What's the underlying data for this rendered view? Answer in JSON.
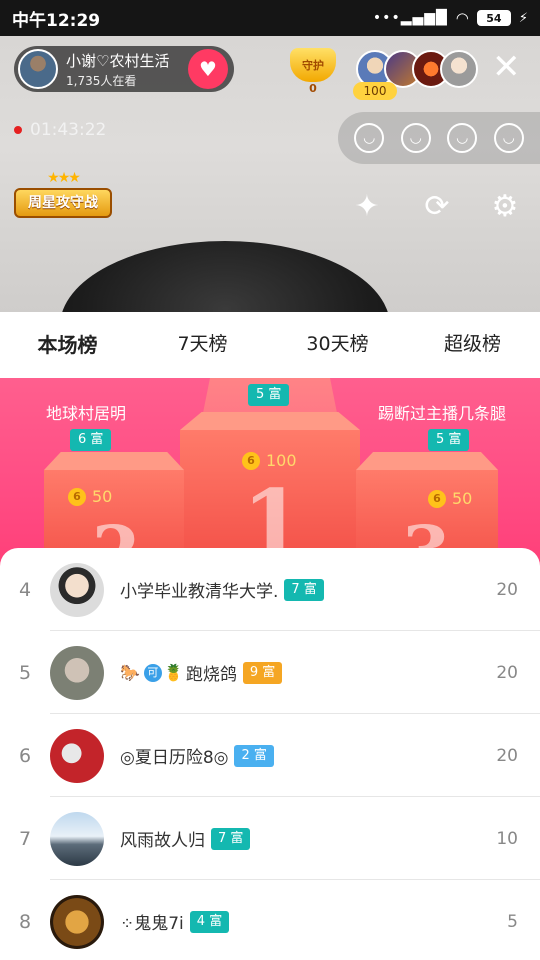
{
  "status_bar": {
    "time": "中午12:29",
    "battery": "54"
  },
  "host": {
    "name": "小谢♡农村生活",
    "viewers": "1,735人在看"
  },
  "guard": {
    "label": "守护",
    "count": "0"
  },
  "top_badge": "100",
  "live_timer": "01:43:22",
  "week_badge": "周星攻守战",
  "tabs": [
    {
      "label": "本场榜",
      "active": true
    },
    {
      "label": "7天榜",
      "active": false
    },
    {
      "label": "30天榜",
      "active": false
    },
    {
      "label": "超级榜",
      "active": false
    }
  ],
  "podium": {
    "first": {
      "rich": "5 富",
      "coins": "100",
      "rank": "1"
    },
    "second": {
      "name": "地球村居明",
      "rich": "6 富",
      "coins": "50",
      "rank": "2"
    },
    "third": {
      "name": "踢断过主播几条腿",
      "rich": "5 富",
      "coins": "50",
      "rank": "3"
    }
  },
  "ranking": [
    {
      "rank": "4",
      "name": "小学毕业教清华大学.",
      "level": "7 富",
      "level_color": "#14b8b0",
      "score": "20"
    },
    {
      "rank": "5",
      "name": "跑烧鸽",
      "level": "9 富",
      "level_color": "#f5a623",
      "score": "20"
    },
    {
      "rank": "6",
      "name": "◎夏日历险8◎",
      "level": "2 富",
      "level_color": "#4ab0f0",
      "score": "20"
    },
    {
      "rank": "7",
      "name": "风雨故人归",
      "level": "7 富",
      "level_color": "#14b8b0",
      "score": "10"
    },
    {
      "rank": "8",
      "name": "⁘鬼鬼7i",
      "level": "4 富",
      "level_color": "#14b8b0",
      "score": "5"
    }
  ],
  "icons": [
    "wifi-icon",
    "signal-icon",
    "heart-plus-icon",
    "close-icon",
    "sofa-seat-icon",
    "magic-wand-icon",
    "camera-flip-icon",
    "settings-icon",
    "coin-icon"
  ]
}
